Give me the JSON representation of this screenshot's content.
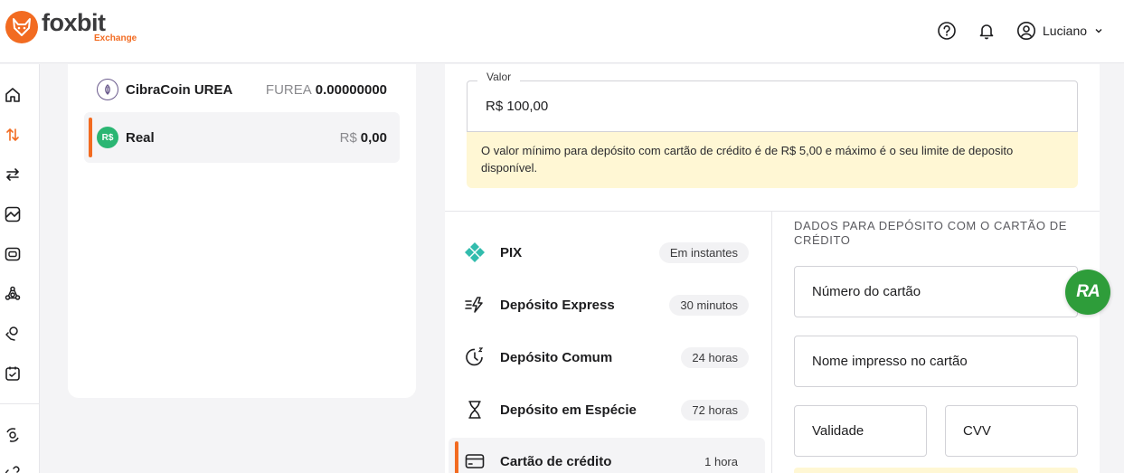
{
  "header": {
    "logo_name": "foxbit",
    "logo_sub": "Exchange",
    "user_name": "Luciano"
  },
  "sidebar": {
    "items": [
      "home-icon",
      "transfer-arrows-icon",
      "swap-icon",
      "chart-icon",
      "wallet-icon",
      "network-icon",
      "money-hand-icon",
      "calendar-icon",
      "target-icon",
      "link-icon"
    ],
    "active": "transfer-arrows-icon"
  },
  "coins": [
    {
      "name": "CibraCoin UREA",
      "symbol": "FUREA",
      "balance": "0.00000000"
    },
    {
      "name": "Real",
      "symbol": "R$",
      "balance": "0,00",
      "icon_text": "R$"
    }
  ],
  "deposit": {
    "amount_label": "Valor",
    "amount_value": "R$ 100,00",
    "warning": "O valor mínimo para depósito com cartão de crédito é de R$ 5,00 e máximo é o seu limite de deposito disponível."
  },
  "methods": [
    {
      "name": "PIX",
      "time": "Em instantes",
      "icon": "pix-icon"
    },
    {
      "name": "Depósito Express",
      "time": "30 minutos",
      "icon": "fast-lightning-icon"
    },
    {
      "name": "Depósito Comum",
      "time": "24 horas",
      "icon": "clock-icon"
    },
    {
      "name": "Depósito em Espécie",
      "time": "72 horas",
      "icon": "hourglass-icon"
    },
    {
      "name": "Cartão de crédito",
      "time": "1 hora",
      "icon": "credit-card-icon"
    }
  ],
  "card_form": {
    "title": "DADOS PARA DEPÓSITO COM O CARTÃO DE CRÉDITO",
    "number_placeholder": "Número do cartão",
    "name_placeholder": "Nome impresso no cartão",
    "expiry_placeholder": "Validade",
    "cvv_placeholder": "CVV"
  },
  "float_badge": "RA",
  "colors": {
    "accent": "#f26b21",
    "warning_bg": "#fff7d4",
    "pix": "#32bcad",
    "real_green": "#2bb673"
  }
}
